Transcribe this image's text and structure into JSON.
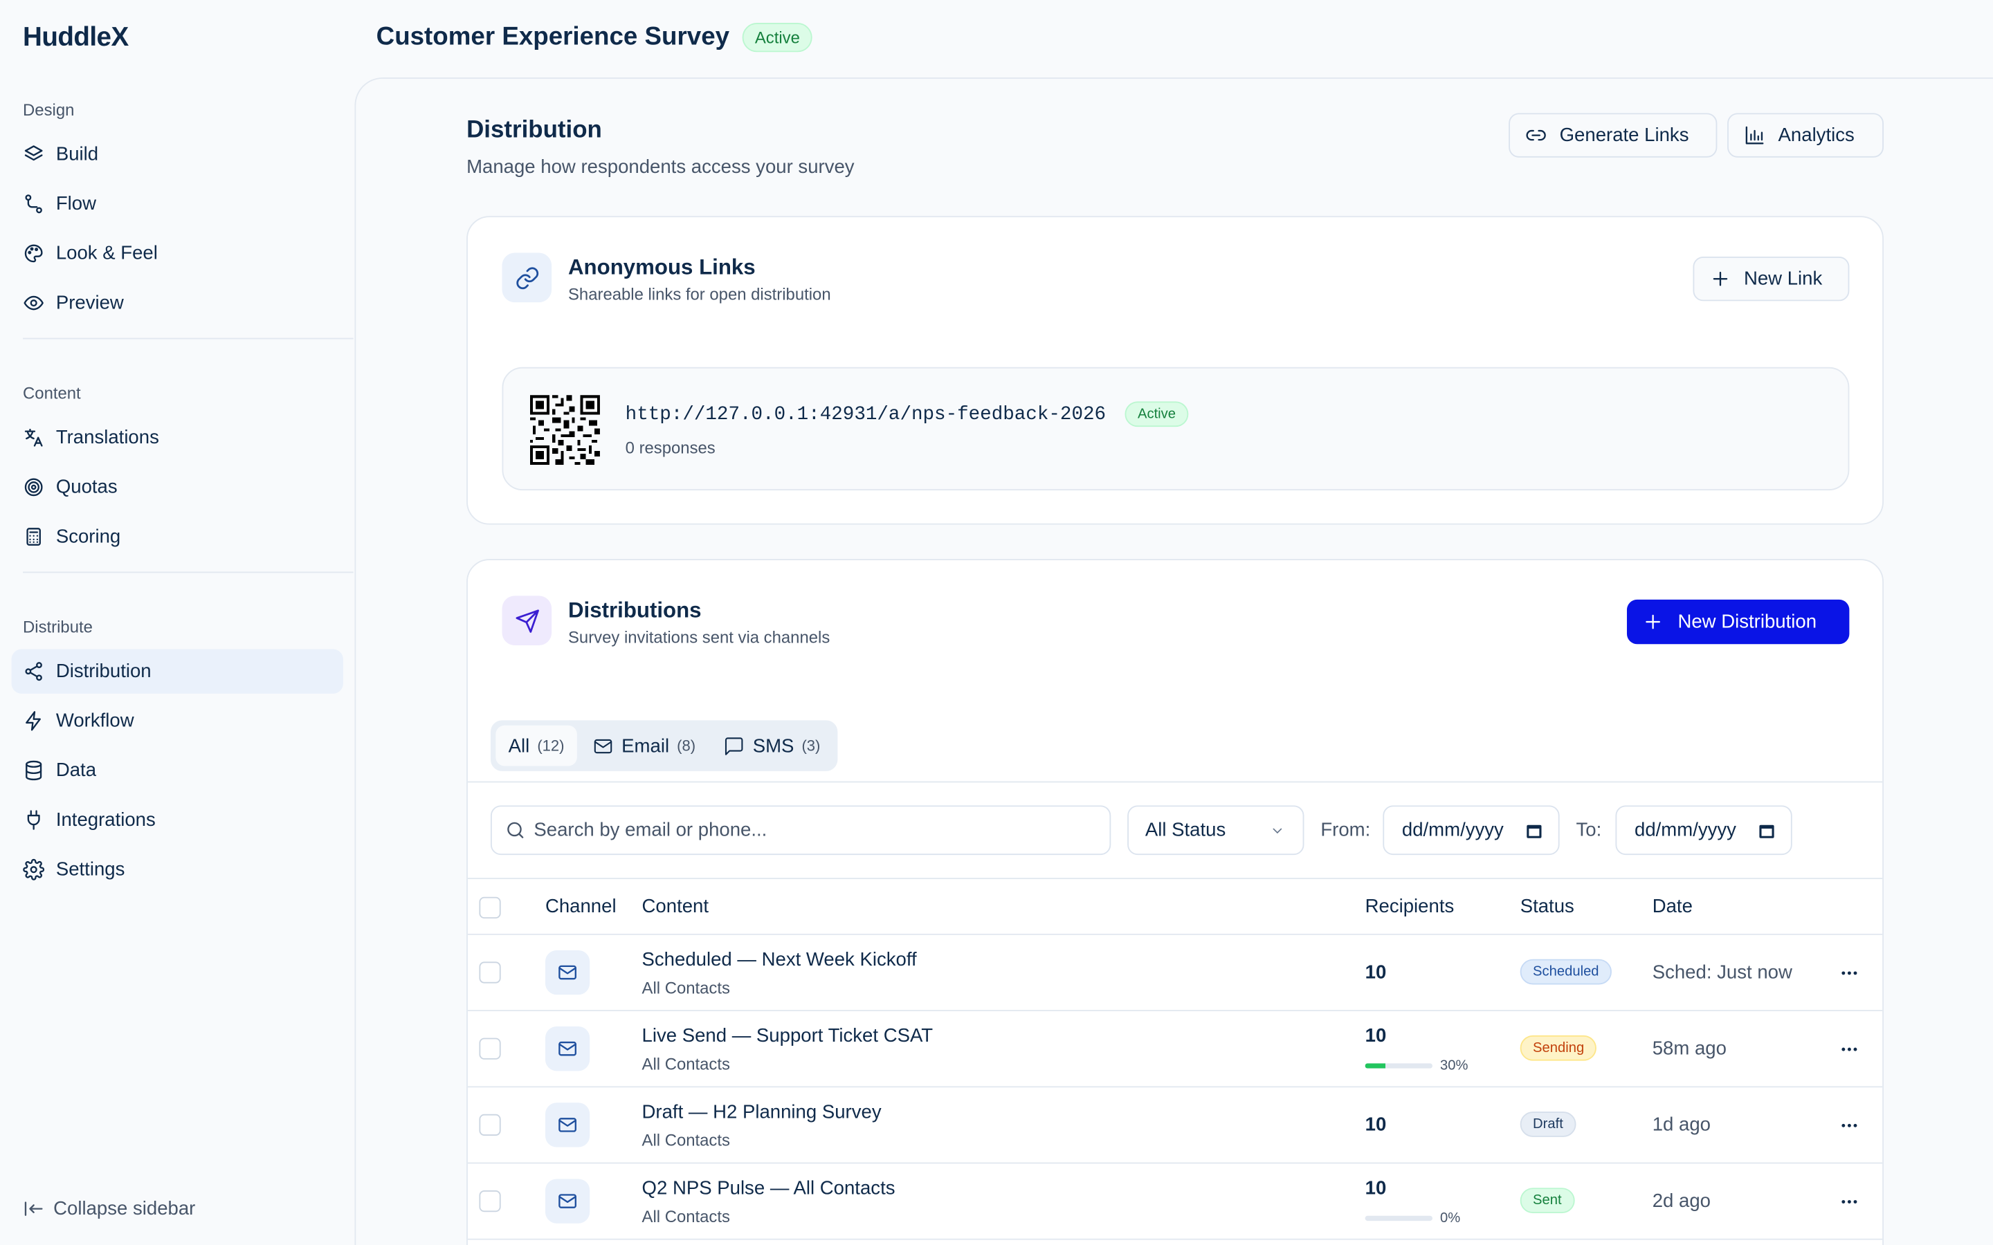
{
  "app": {
    "logo": "HuddleX"
  },
  "header": {
    "title": "Customer Experience Survey",
    "status": "Active"
  },
  "sidebar": {
    "sections": [
      {
        "label": "Design",
        "items": [
          {
            "label": "Build",
            "icon": "layers-icon"
          },
          {
            "label": "Flow",
            "icon": "route-icon"
          },
          {
            "label": "Look & Feel",
            "icon": "palette-icon"
          },
          {
            "label": "Preview",
            "icon": "eye-icon"
          }
        ]
      },
      {
        "label": "Content",
        "items": [
          {
            "label": "Translations",
            "icon": "translate-icon"
          },
          {
            "label": "Quotas",
            "icon": "target-icon"
          },
          {
            "label": "Scoring",
            "icon": "calculator-icon"
          }
        ]
      },
      {
        "label": "Distribute",
        "items": [
          {
            "label": "Distribution",
            "icon": "share-icon",
            "active": true
          },
          {
            "label": "Workflow",
            "icon": "zap-icon"
          },
          {
            "label": "Data",
            "icon": "database-icon"
          },
          {
            "label": "Integrations",
            "icon": "plug-icon"
          },
          {
            "label": "Settings",
            "icon": "gear-icon"
          }
        ]
      }
    ],
    "collapse_label": "Collapse sidebar"
  },
  "main": {
    "title": "Distribution",
    "subtitle": "Manage how respondents access your survey",
    "generate_links_label": "Generate Links",
    "analytics_label": "Analytics"
  },
  "anonymous_links": {
    "title": "Anonymous Links",
    "subtitle": "Shareable links for open distribution",
    "new_link_label": "New Link",
    "link": {
      "url": "http://127.0.0.1:42931/a/nps-feedback-2026",
      "status": "Active",
      "responses": "0 responses"
    }
  },
  "distributions": {
    "title": "Distributions",
    "subtitle": "Survey invitations sent via channels",
    "new_label": "New Distribution",
    "tabs": [
      {
        "label": "All",
        "count": "(12)",
        "active": true
      },
      {
        "label": "Email",
        "count": "(8)"
      },
      {
        "label": "SMS",
        "count": "(3)"
      }
    ],
    "search_placeholder": "Search by email or phone...",
    "status_filter": "All Status",
    "from_label": "From:",
    "to_label": "To:",
    "date_placeholder": "dd/mm/yyyy",
    "columns": [
      "Channel",
      "Content",
      "Recipients",
      "Status",
      "Date"
    ],
    "rows": [
      {
        "title": "Scheduled — Next Week Kickoff",
        "audience": "All Contacts",
        "recipients": "10",
        "status": "Scheduled",
        "status_kind": "sched",
        "date": "Sched: Just now"
      },
      {
        "title": "Live Send — Support Ticket CSAT",
        "audience": "All Contacts",
        "recipients": "10",
        "progress": 0.3,
        "progress_label": "30%",
        "status": "Sending",
        "status_kind": "sending",
        "date": "58m ago"
      },
      {
        "title": "Draft — H2 Planning Survey",
        "audience": "All Contacts",
        "recipients": "10",
        "status": "Draft",
        "status_kind": "draft",
        "date": "1d ago"
      },
      {
        "title": "Q2 NPS Pulse — All Contacts",
        "audience": "All Contacts",
        "recipients": "10",
        "progress": 0,
        "progress_label": "0%",
        "status": "Sent",
        "status_kind": "sent",
        "date": "2d ago"
      }
    ]
  },
  "colors": {
    "accent": "#0a14e6",
    "text": "#0f2a4a",
    "success": "#15803d",
    "warning": "#c2410c"
  }
}
